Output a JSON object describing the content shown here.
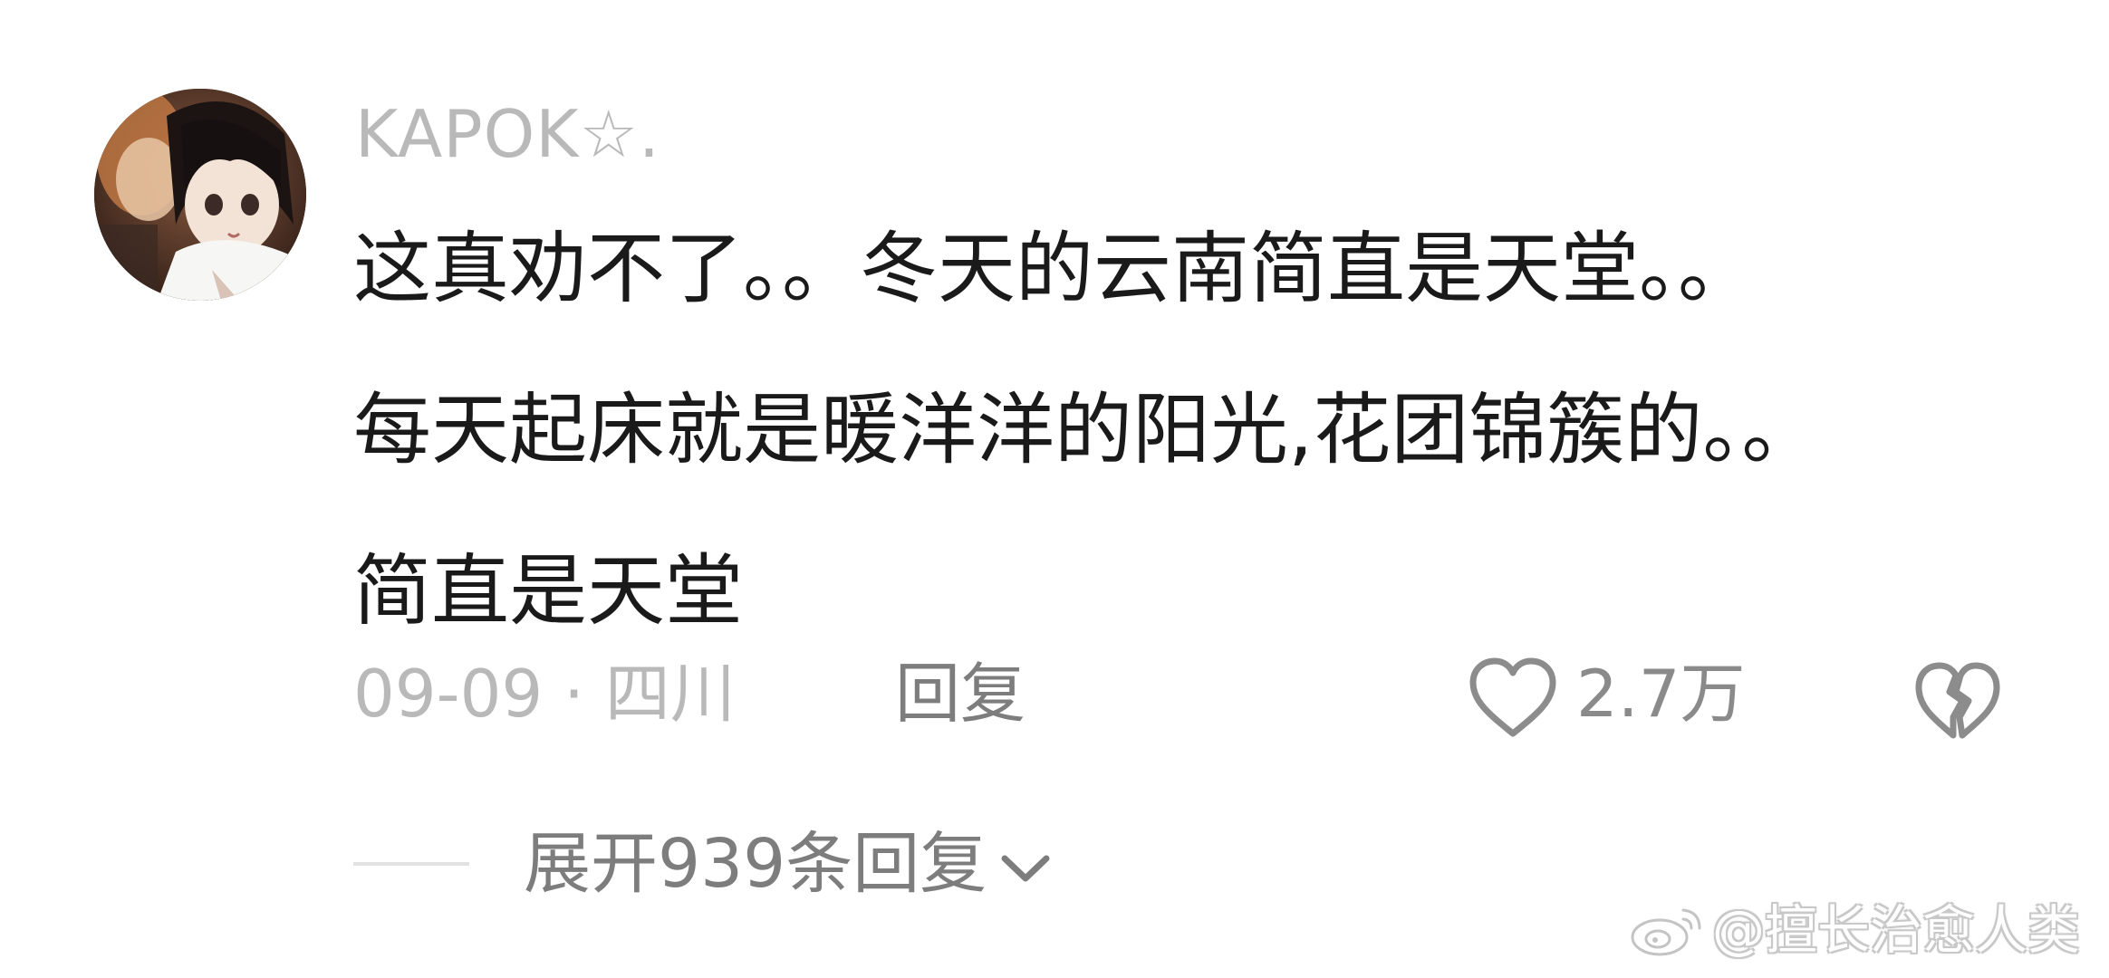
{
  "comment": {
    "username": "KAPOK☆.",
    "lines": [
      "这真劝不了。。冬天的云南简直是天堂。。",
      "每天起床就是暖洋洋的阳光,花团锦簇的。。",
      "简直是天堂"
    ],
    "meta": "09-09 · 四川",
    "reply_label": "回复",
    "like_count": "2.7万",
    "expand_label": "展开939条回复"
  },
  "icons": {
    "like": "heart-outline-icon",
    "dislike": "broken-heart-icon",
    "expand": "chevron-down-icon",
    "watermark": "weibo-logo-icon"
  },
  "watermark": {
    "text": "@擅长治愈人类"
  },
  "colors": {
    "username": "#b9b9b9",
    "body": "#1a1a1a",
    "meta": "#b9b9b9",
    "action": "#7d7d7d",
    "background": "#ffffff"
  }
}
